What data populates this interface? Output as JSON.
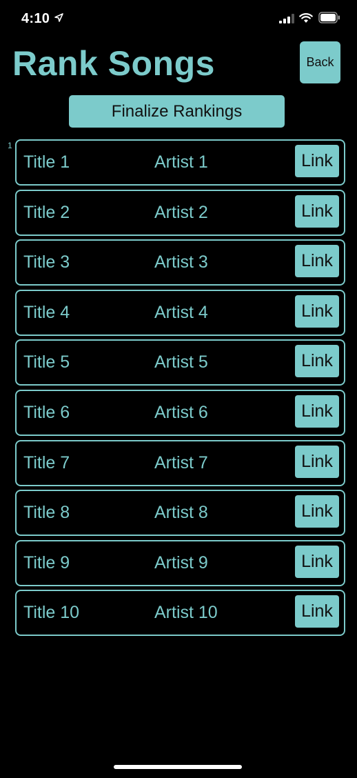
{
  "status_bar": {
    "time": "4:10"
  },
  "header": {
    "title": "Rank Songs",
    "back_label": "Back"
  },
  "finalize_label": "Finalize Rankings",
  "first_rank_label": "1",
  "songs": [
    {
      "title": "Title 1",
      "artist": "Artist 1",
      "link_label": "Link"
    },
    {
      "title": "Title 2",
      "artist": "Artist 2",
      "link_label": "Link"
    },
    {
      "title": "Title 3",
      "artist": "Artist 3",
      "link_label": "Link"
    },
    {
      "title": "Title 4",
      "artist": "Artist 4",
      "link_label": "Link"
    },
    {
      "title": "Title 5",
      "artist": "Artist 5",
      "link_label": "Link"
    },
    {
      "title": "Title 6",
      "artist": "Artist 6",
      "link_label": "Link"
    },
    {
      "title": "Title 7",
      "artist": "Artist 7",
      "link_label": "Link"
    },
    {
      "title": "Title 8",
      "artist": "Artist 8",
      "link_label": "Link"
    },
    {
      "title": "Title 9",
      "artist": "Artist 9",
      "link_label": "Link"
    },
    {
      "title": "Title 10",
      "artist": "Artist 10",
      "link_label": "Link"
    }
  ],
  "icons": {
    "location": "location-arrow-icon",
    "signal": "cellular-signal-icon",
    "wifi": "wifi-icon",
    "battery": "battery-icon"
  },
  "colors": {
    "accent": "#7ccbcb",
    "background": "#000000",
    "button_text": "#111111",
    "status_text": "#ffffff"
  }
}
